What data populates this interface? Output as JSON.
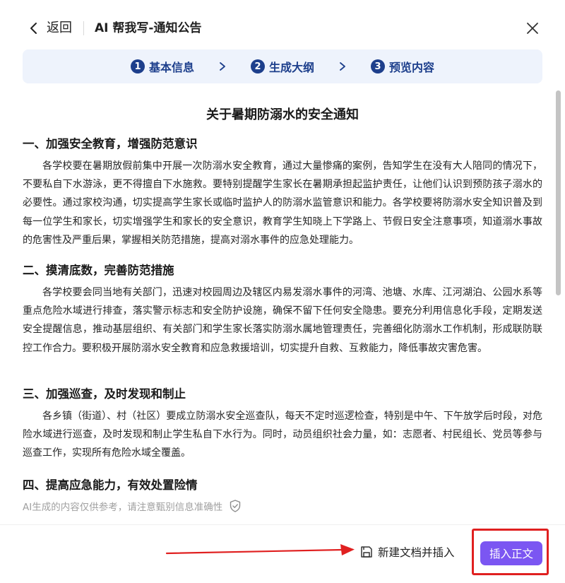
{
  "header": {
    "back_label": "返回",
    "title": "AI 帮我写-通知公告"
  },
  "steps": [
    {
      "num": "1",
      "label": "基本信息"
    },
    {
      "num": "2",
      "label": "生成大纲"
    },
    {
      "num": "3",
      "label": "预览内容"
    }
  ],
  "document": {
    "title": "关于暑期防溺水的安全通知",
    "sections": [
      {
        "heading": "一、加强安全教育，增强防范意识",
        "body": "各学校要在暑期放假前集中开展一次防溺水安全教育，通过大量惨痛的案例，告知学生在没有大人陪同的情况下，不要私自下水游泳，更不得擅自下水施救。要特别提醒学生家长在暑期承担起监护责任，让他们认识到预防孩子溺水的必要性。通过家校沟通，切实提高学生家长或临时监护人的防溺水监管意识和能力。各学校要将防溺水安全知识普及到每一位学生和家长，切实增强学生和家长的安全意识，教育学生知晓上下学路上、节假日安全注意事项，知道溺水事故的危害性及严重后果，掌握相关防范措施，提高对溺水事件的应急处理能力。"
      },
      {
        "heading": "二、摸清底数，完善防范措施",
        "body": "各学校要会同当地有关部门，迅速对校园周边及辖区内易发溺水事件的河湾、池塘、水库、江河湖泊、公园水系等重点危险水域进行排查，落实警示标志和安全防护设施，确保不留下任何安全隐患。要充分利用信息化手段，定期发送安全提醒信息，推动基层组织、有关部门和学生家长落实防溺水属地管理责任，完善细化防溺水工作机制，形成联防联控工作合力。要积极开展防溺水安全教育和应急救援培训，切实提升自救、互救能力，降低事故灾害危害。"
      },
      {
        "heading": "三、加强巡查，及时发现和制止",
        "body": "各乡镇（街道）、村（社区）要成立防溺水安全巡查队，每天不定时巡逻检查，特别是中午、下午放学后时段，对危险水域进行巡查，及时发现和制止学生私自下水行为。同时，动员组织社会力量，如：志愿者、村民组长、党员等参与巡查工作，实现所有危险水域全覆盖。"
      },
      {
        "heading": "四、提高应急能力，有效处置险情",
        "body": ""
      }
    ]
  },
  "disclaimer": "AI生成的内容仅供参考，请注意甄别信息准确性",
  "footer": {
    "new_doc_label": "新建文档并插入",
    "insert_label": "插入正文"
  },
  "colors": {
    "accent": "#7b56f2",
    "step_text": "#1d3f8c",
    "step_bg": "#eef3fc",
    "highlight": "#e02020"
  },
  "icons": [
    "chevron-left-icon",
    "close-icon",
    "chevron-right-icon",
    "shield-check-icon",
    "save-doc-icon"
  ]
}
